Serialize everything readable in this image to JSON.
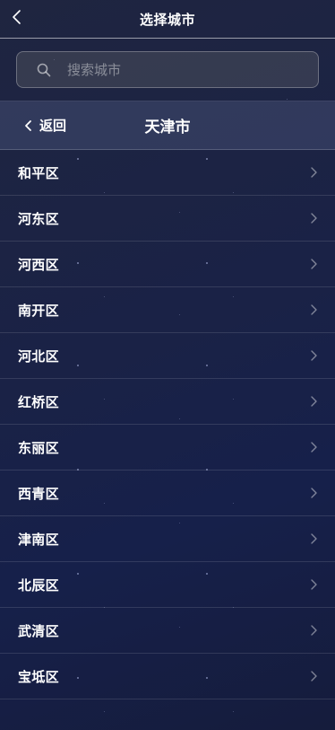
{
  "header": {
    "title": "选择城市"
  },
  "search": {
    "placeholder": "搜索城市"
  },
  "city_header": {
    "back_label": "返回",
    "city_name": "天津市"
  },
  "districts": [
    {
      "label": "和平区"
    },
    {
      "label": "河东区"
    },
    {
      "label": "河西区"
    },
    {
      "label": "南开区"
    },
    {
      "label": "河北区"
    },
    {
      "label": "红桥区"
    },
    {
      "label": "东丽区"
    },
    {
      "label": "西青区"
    },
    {
      "label": "津南区"
    },
    {
      "label": "北辰区"
    },
    {
      "label": "武清区"
    },
    {
      "label": "宝坻区"
    }
  ],
  "colors": {
    "background": "#1a2246",
    "text": "#ffffff",
    "divider": "#2f3756"
  }
}
